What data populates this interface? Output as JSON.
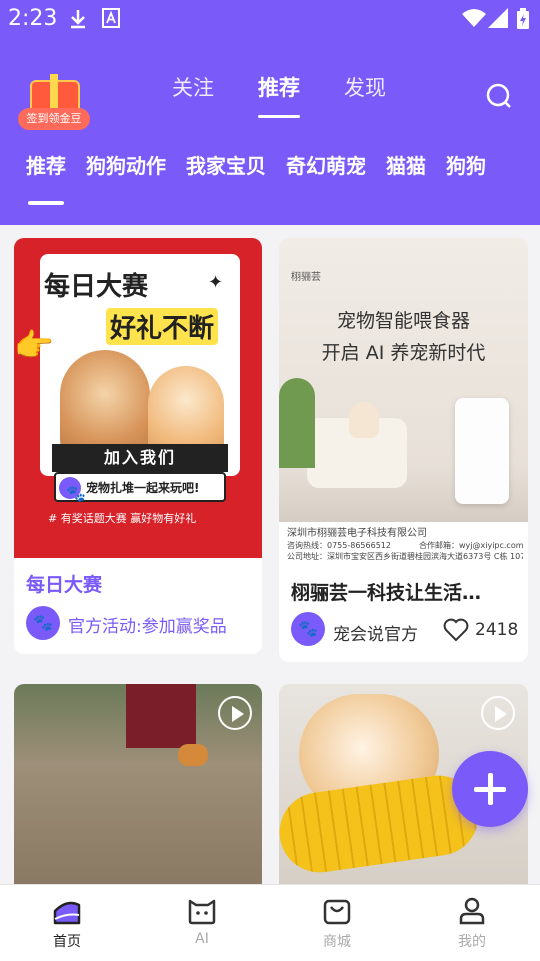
{
  "status_bar": {
    "time": "2:23"
  },
  "header": {
    "gift_label": "签到领金豆",
    "tabs": [
      "关注",
      "推荐",
      "发现"
    ],
    "active_tab": "推荐",
    "categories": [
      "推荐",
      "狗狗动作",
      "我家宝贝",
      "奇幻萌宠",
      "猫猫",
      "狗狗"
    ],
    "active_category": "推荐"
  },
  "feed": {
    "card1": {
      "banner_title": "每日大赛",
      "banner_subtitle": "好礼不断",
      "banner_join": "加入我们",
      "banner_slogan": "宠物扎堆一起来玩吧!",
      "banner_footer": "# 有奖话题大赛   赢好物有好礼",
      "title": "每日大赛",
      "desc": "官方活动:参加赢奖品"
    },
    "card2": {
      "brand": "栩骊芸",
      "ad_line1": "宠物智能喂食器",
      "ad_line2": "开启 AI 养宠新时代",
      "company": "深圳市栩骊芸电子科技有限公司",
      "hotline": "咨询热线：0755-86566512",
      "email": "合作邮箱：wyj@xiyipc.com",
      "address": "公司地址：深圳市宝安区西乡街道碧桂园滨海大道6373号 C栋 107",
      "title": "栩骊芸一科技让生活…",
      "author": "宠会说官方",
      "likes": "2418"
    }
  },
  "bottom_nav": [
    {
      "label": "首页",
      "icon": "home-icon"
    },
    {
      "label": "AI",
      "icon": "cat-face-icon"
    },
    {
      "label": "商城",
      "icon": "shopping-bag-icon"
    },
    {
      "label": "我的",
      "icon": "user-icon"
    }
  ],
  "colors": {
    "brand": "#7a5af8",
    "banner_red": "#d8222a"
  }
}
